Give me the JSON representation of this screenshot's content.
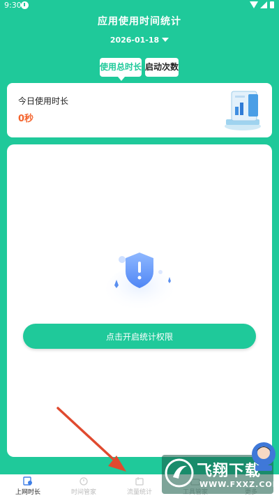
{
  "status_bar": {
    "time": "9:30"
  },
  "header": {
    "title": "应用使用时间统计",
    "date": "2026-01-18"
  },
  "tabs": [
    {
      "label": "使用总时长",
      "active": true
    },
    {
      "label": "启动次数",
      "active": false
    }
  ],
  "today_card": {
    "label": "今日使用时长",
    "value": "0秒"
  },
  "permission_panel": {
    "button_label": "点击开启统计权限"
  },
  "bottom_nav": [
    {
      "label": "上网时长",
      "icon": "usage-icon",
      "active": true
    },
    {
      "label": "时间管家",
      "icon": "clock-icon",
      "active": false
    },
    {
      "label": "流量统计",
      "icon": "traffic-icon",
      "active": false
    },
    {
      "label": "工具管家",
      "icon": "toolbox-icon",
      "active": false
    },
    {
      "label": "更多",
      "icon": "more-icon",
      "active": false
    }
  ],
  "watermark": {
    "title": "飞翔下载",
    "url": "WWW.FXXZ.COM"
  },
  "colors": {
    "accent": "#1fc99a",
    "value_orange": "#f4642e",
    "arrow_red": "#e04a2f"
  }
}
